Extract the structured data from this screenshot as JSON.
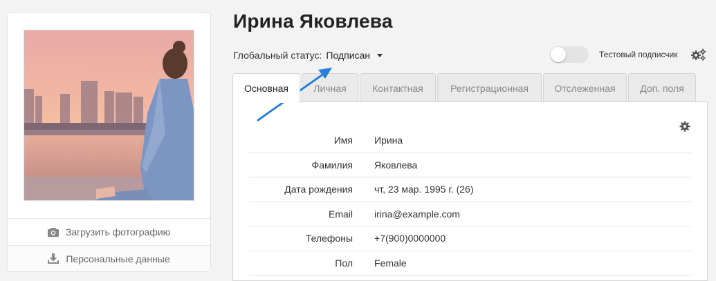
{
  "profile": {
    "name": "Ирина Яковлева",
    "global_status_label": "Глобальный статус:",
    "global_status_value": "Подписан",
    "test_subscriber_label": "Тестовый подписчик",
    "test_subscriber_on": false
  },
  "card": {
    "upload_photo_label": "Загрузить фотографию",
    "personal_data_label": "Персональные данные"
  },
  "tabs": [
    {
      "label": "Основная",
      "active": true
    },
    {
      "label": "Личная",
      "active": false
    },
    {
      "label": "Контактная",
      "active": false
    },
    {
      "label": "Регистрационная",
      "active": false
    },
    {
      "label": "Отслеженная",
      "active": false
    },
    {
      "label": "Доп. поля",
      "active": false
    }
  ],
  "fields": [
    {
      "label": "Имя",
      "value": "Ирина"
    },
    {
      "label": "Фамилия",
      "value": "Яковлева"
    },
    {
      "label": "Дата рождения",
      "value": "чт, 23 мар. 1995 г. (26)"
    },
    {
      "label": "Email",
      "value": "irina@example.com"
    },
    {
      "label": "Телефоны",
      "value": "+7(900)0000000"
    },
    {
      "label": "Пол",
      "value": "Female"
    }
  ],
  "colors": {
    "annotation_arrow": "#2a7fd8",
    "page_background": "#f3f3f3"
  },
  "icons": {
    "upload": "camera-icon",
    "personal": "download-icon",
    "settings": "gears-icon",
    "panel_settings": "gear-icon"
  }
}
